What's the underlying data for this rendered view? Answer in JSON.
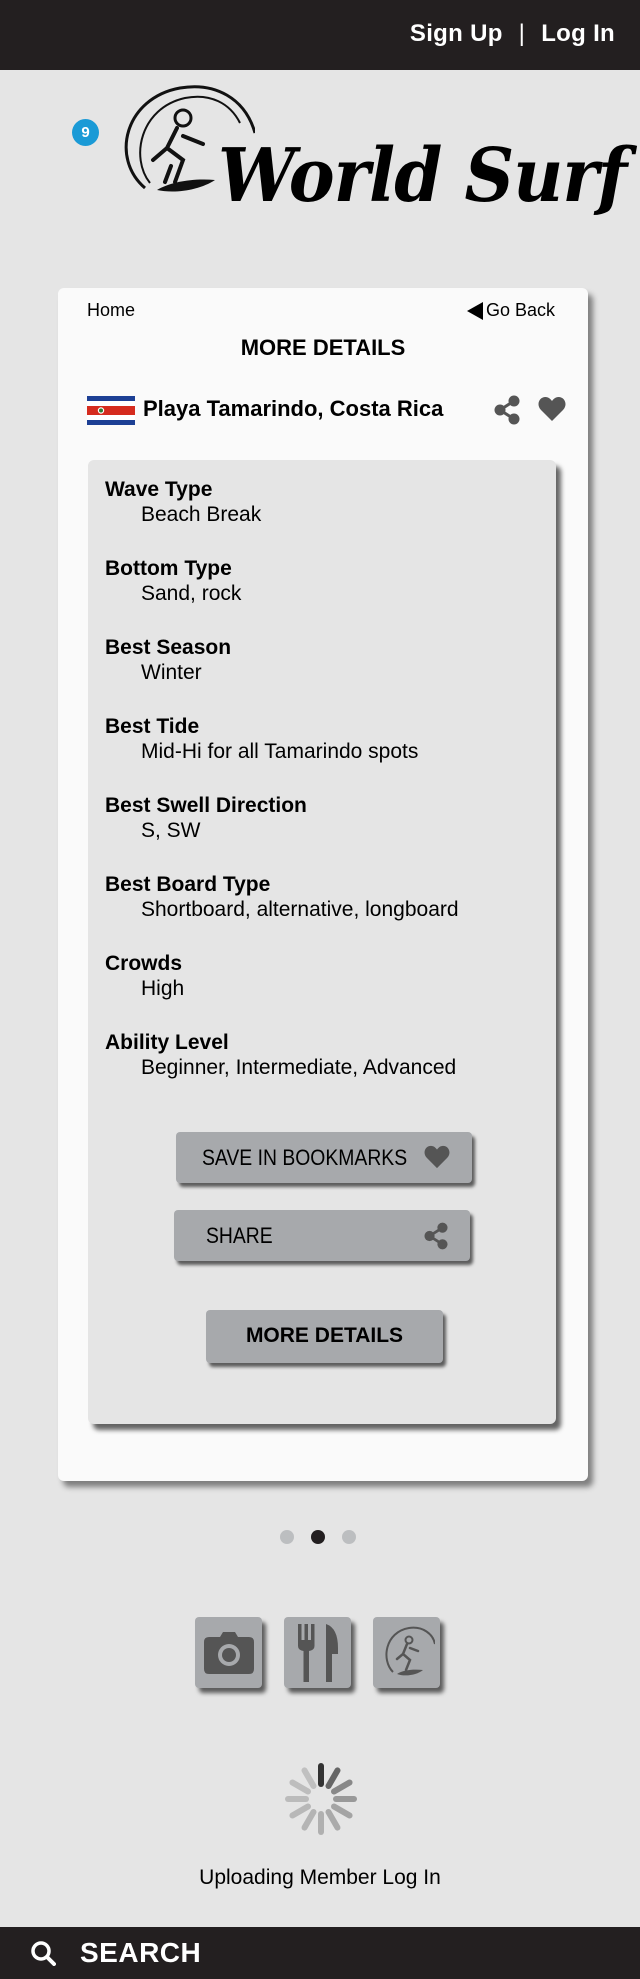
{
  "header": {
    "signup_label": "Sign Up",
    "separator": "|",
    "login_label": "Log In"
  },
  "logo": {
    "badge_count": "9",
    "brand_text": "World Surf"
  },
  "breadcrumb": {
    "home_label": "Home",
    "back_label": "Go Back"
  },
  "page_title": "MORE DETAILS",
  "spot": {
    "name": "Playa Tamarindo, Costa Rica",
    "flag": "costa-rica-flag",
    "share_icon": "share-icon",
    "favorite_icon": "heart-icon"
  },
  "details": [
    {
      "label": "Wave Type",
      "value": "Beach Break"
    },
    {
      "label": "Bottom Type",
      "value": "Sand, rock"
    },
    {
      "label": "Best Season",
      "value": "Winter"
    },
    {
      "label": "Best Tide",
      "value": "Mid-Hi for all Tamarindo spots"
    },
    {
      "label": "Best Swell Direction",
      "value": "S, SW"
    },
    {
      "label": "Best Board Type",
      "value": "Shortboard, alternative, longboard"
    },
    {
      "label": "Crowds",
      "value": "High"
    },
    {
      "label": "Ability Level",
      "value": "Beginner, Intermediate, Advanced"
    }
  ],
  "actions": {
    "bookmarks_label": "SAVE IN BOOKMARKS",
    "share_label": "SHARE",
    "more_details_label": "MORE DETAILS"
  },
  "pager": {
    "pages": 3,
    "active_index": 1
  },
  "category_tiles": [
    "camera-icon",
    "fork-knife-icon",
    "surfer-icon"
  ],
  "status": {
    "loading_message": "Uploading Member Log In"
  },
  "search": {
    "label": "SEARCH"
  },
  "colors": {
    "bar_dark": "#231f20",
    "page_bg": "#e5e5e5",
    "button_gray": "#a7a9ac",
    "badge_blue": "#1a9ad6"
  }
}
